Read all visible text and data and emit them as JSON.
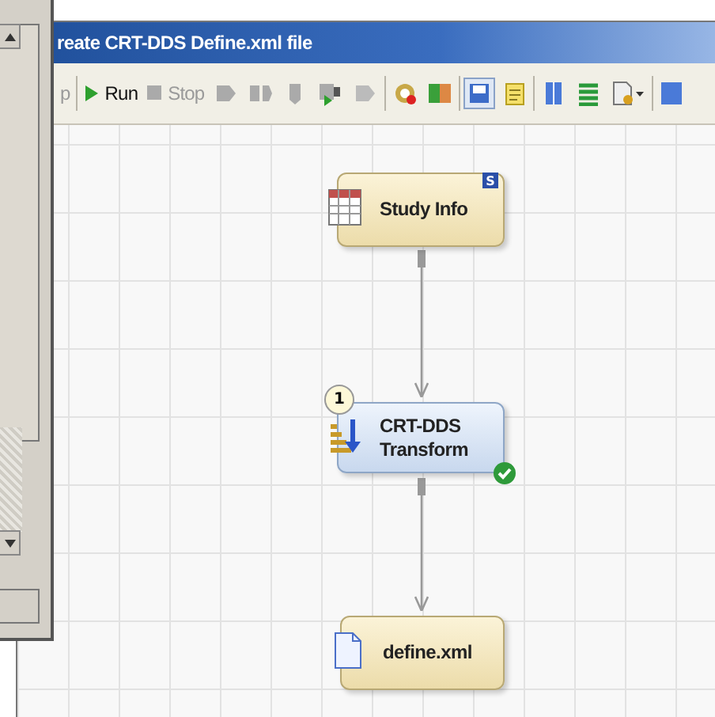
{
  "window": {
    "title": "reate CRT-DDS Define.xml file"
  },
  "toolbar": [
    {
      "label": "p",
      "disabled": true
    },
    {
      "label": "Run",
      "disabled": false
    },
    {
      "label": "Stop",
      "disabled": true
    }
  ],
  "nodes": [
    {
      "kind": "table",
      "label": "Study Info",
      "badge": "S"
    },
    {
      "kind": "transform",
      "label": "CRT-DDS Transform",
      "step": "1",
      "done": true
    },
    {
      "kind": "file",
      "label": "define.xml"
    }
  ]
}
